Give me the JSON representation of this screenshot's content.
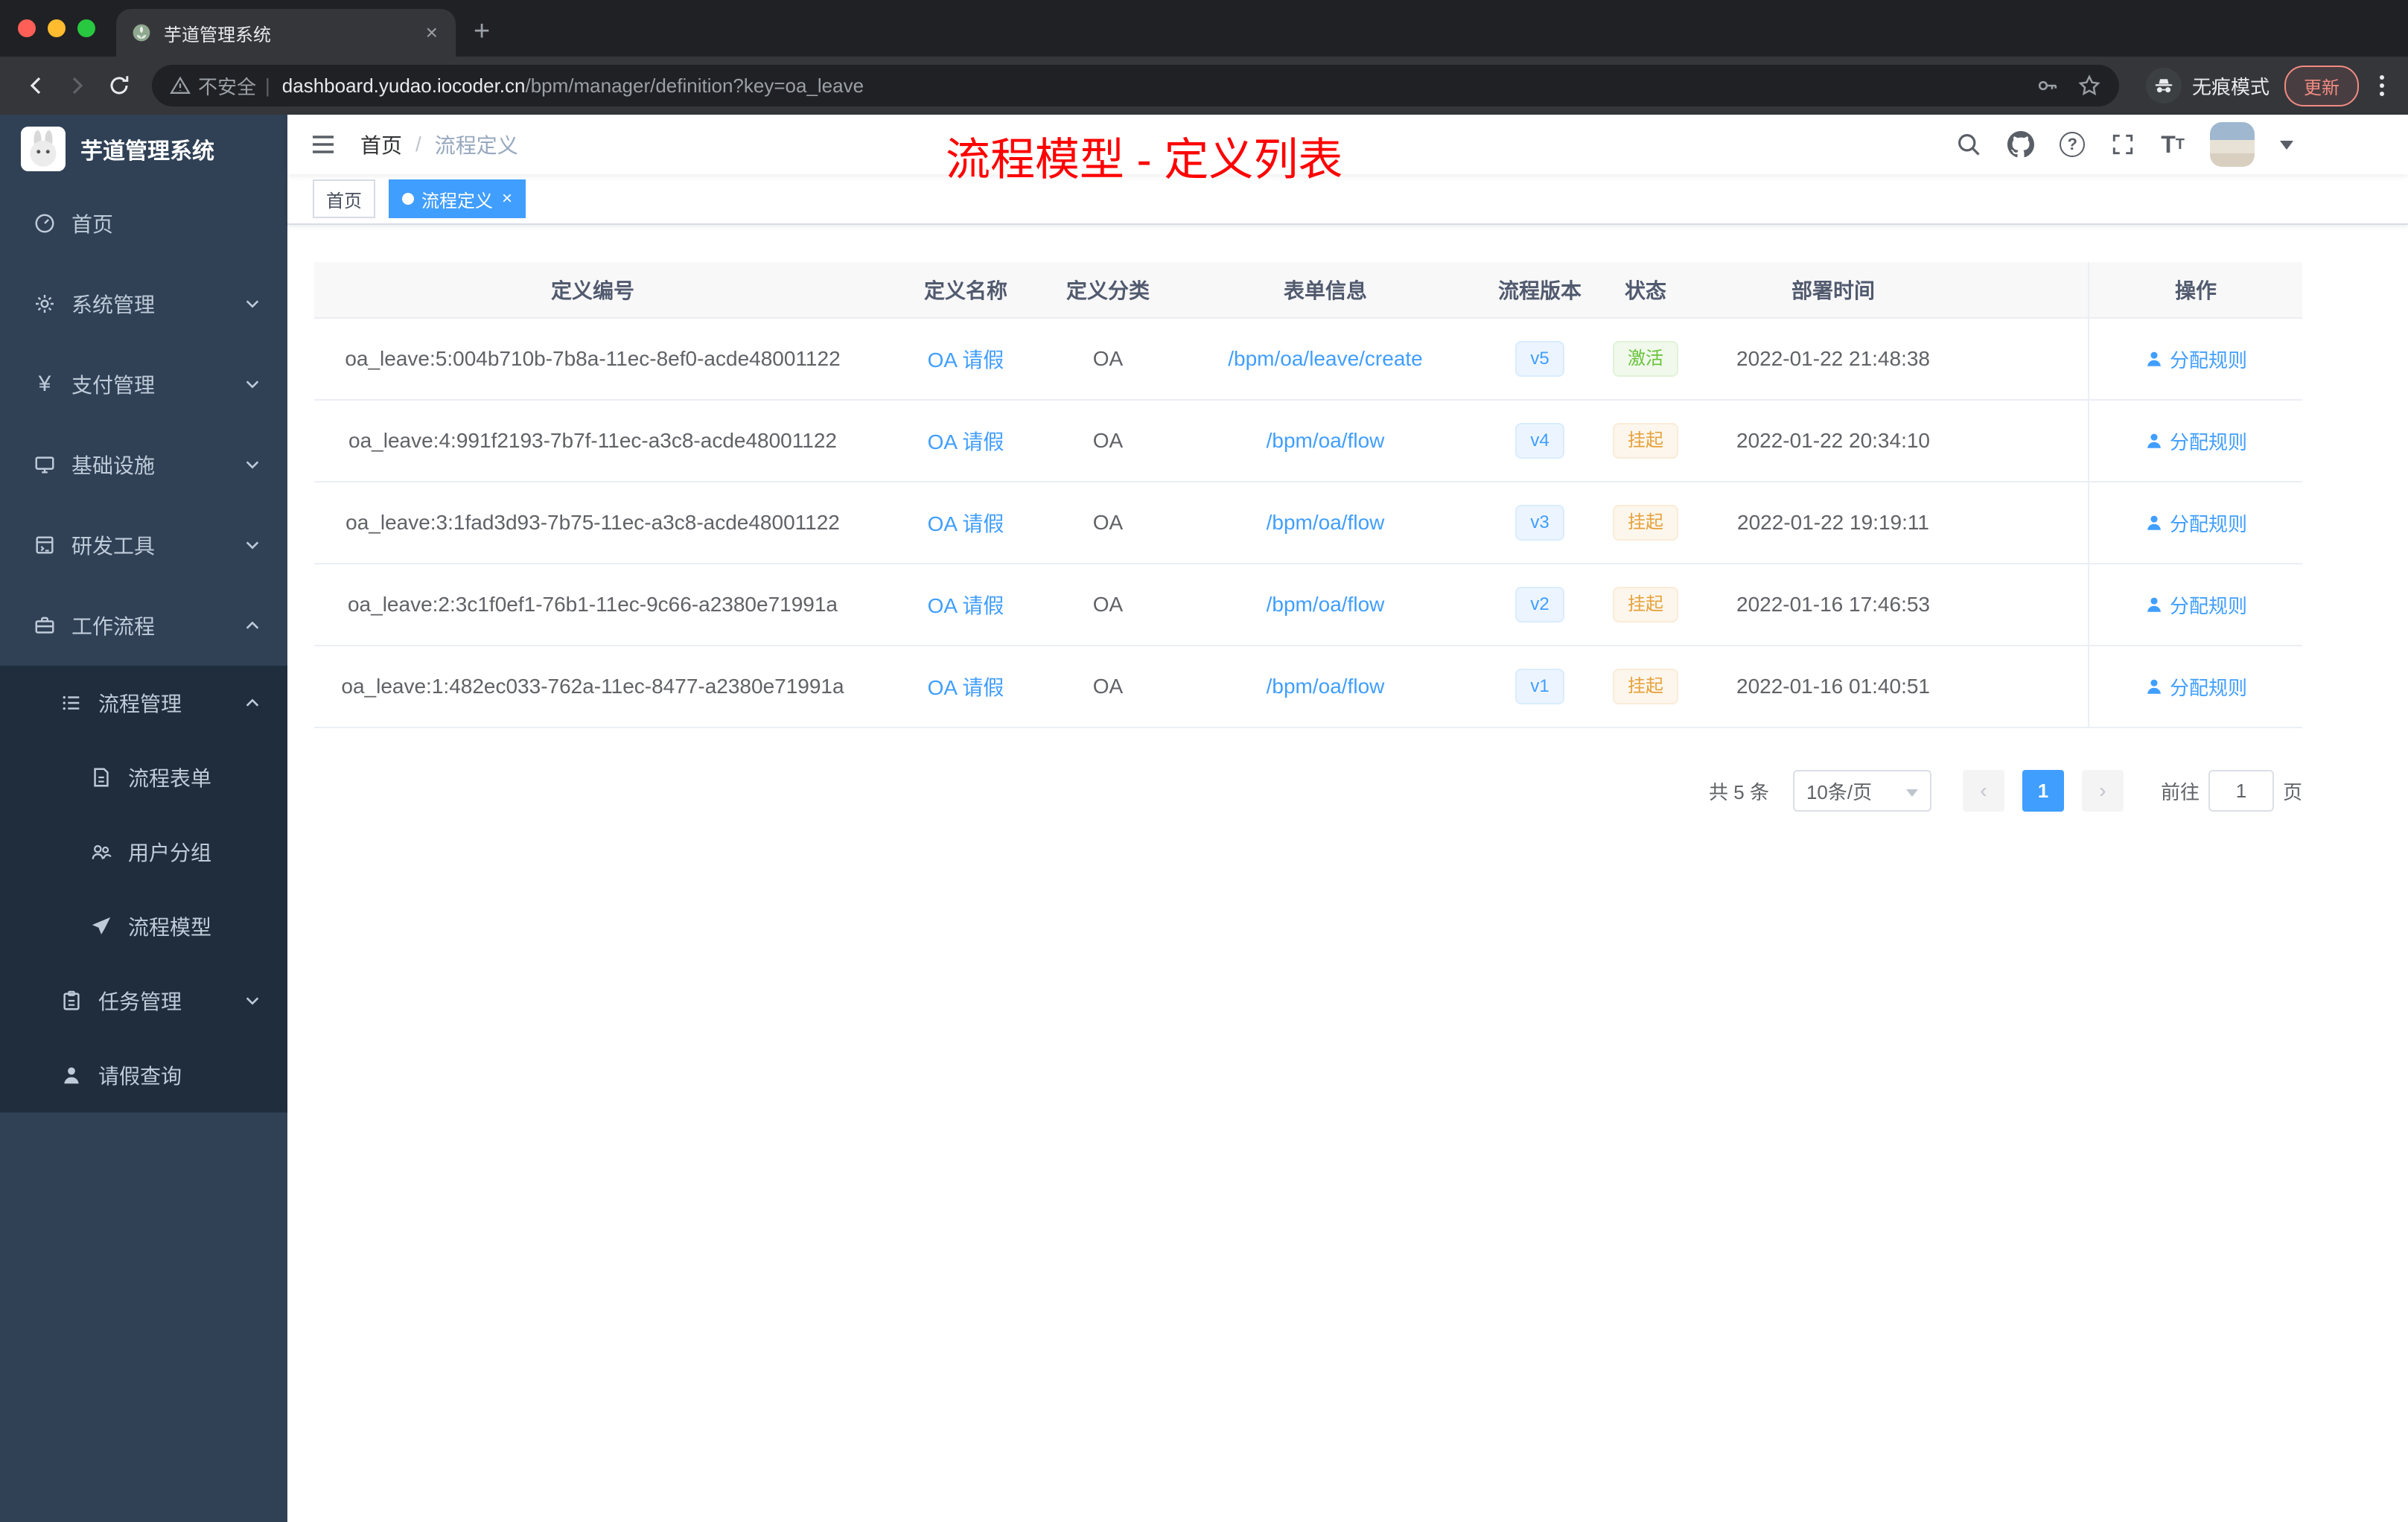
{
  "browser": {
    "tab_title": "芋道管理系统",
    "security_label": "不安全",
    "url_host": "dashboard.yudao.iocoder.cn",
    "url_path": "/bpm/manager/definition?key=oa_leave",
    "incognito_label": "无痕模式",
    "update_label": "更新"
  },
  "sidebar": {
    "logo_title": "芋道管理系统",
    "items": [
      {
        "label": "首页",
        "icon": "dashboard-icon"
      },
      {
        "label": "系统管理",
        "icon": "gear-icon",
        "state": "collapsed"
      },
      {
        "label": "支付管理",
        "icon": "payment-icon",
        "state": "collapsed"
      },
      {
        "label": "基础设施",
        "icon": "infrastructure-icon",
        "state": "collapsed"
      },
      {
        "label": "研发工具",
        "icon": "devtools-icon",
        "state": "collapsed"
      },
      {
        "label": "工作流程",
        "icon": "workflow-icon",
        "state": "expanded"
      },
      {
        "label": "流程管理",
        "icon": "process-manage-icon",
        "state": "expanded"
      },
      {
        "label": "流程表单",
        "icon": "form-icon"
      },
      {
        "label": "用户分组",
        "icon": "user-group-icon"
      },
      {
        "label": "流程模型",
        "icon": "process-model-icon"
      },
      {
        "label": "任务管理",
        "icon": "task-manage-icon",
        "state": "collapsed"
      },
      {
        "label": "请假查询",
        "icon": "leave-query-icon"
      }
    ]
  },
  "navbar": {
    "breadcrumb": {
      "home": "首页",
      "separator": "/",
      "current": "流程定义"
    },
    "annotation": "流程模型 - 定义列表"
  },
  "tags": {
    "home": "首页",
    "active": "流程定义"
  },
  "table": {
    "headers": [
      "定义编号",
      "定义名称",
      "定义分类",
      "表单信息",
      "流程版本",
      "状态",
      "部署时间",
      "操作"
    ],
    "rows": [
      {
        "id": "oa_leave:5:004b710b-7b8a-11ec-8ef0-acde48001122",
        "name": "OA 请假",
        "category": "OA",
        "form": "/bpm/oa/leave/create",
        "version": "v5",
        "status": "激活",
        "deployed": "2022-01-22 21:48:38",
        "action": "分配规则"
      },
      {
        "id": "oa_leave:4:991f2193-7b7f-11ec-a3c8-acde48001122",
        "name": "OA 请假",
        "category": "OA",
        "form": "/bpm/oa/flow",
        "version": "v4",
        "status": "挂起",
        "deployed": "2022-01-22 20:34:10",
        "action": "分配规则"
      },
      {
        "id": "oa_leave:3:1fad3d93-7b75-11ec-a3c8-acde48001122",
        "name": "OA 请假",
        "category": "OA",
        "form": "/bpm/oa/flow",
        "version": "v3",
        "status": "挂起",
        "deployed": "2022-01-22 19:19:11",
        "action": "分配规则"
      },
      {
        "id": "oa_leave:2:3c1f0ef1-76b1-11ec-9c66-a2380e71991a",
        "name": "OA 请假",
        "category": "OA",
        "form": "/bpm/oa/flow",
        "version": "v2",
        "status": "挂起",
        "deployed": "2022-01-16 17:46:53",
        "action": "分配规则"
      },
      {
        "id": "oa_leave:1:482ec033-762a-11ec-8477-a2380e71991a",
        "name": "OA 请假",
        "category": "OA",
        "form": "/bpm/oa/flow",
        "version": "v1",
        "status": "挂起",
        "deployed": "2022-01-16 01:40:51",
        "action": "分配规则"
      }
    ]
  },
  "pagination": {
    "total": "共 5 条",
    "page_size": "10条/页",
    "page": "1",
    "goto_label": "前往",
    "goto_value": "1",
    "unit_label": "页"
  },
  "colors": {
    "accent": "#409eff",
    "annotation_red": "#fe0100",
    "status_active": "#67c23a",
    "status_suspended": "#e6a23c",
    "sidebar_bg": "#304156",
    "sidebar_sub_bg": "#1f2d3d"
  },
  "icons": {
    "search-icon": "magnifier",
    "github-icon": "github octocat",
    "help-icon": "question circle",
    "fullscreen-icon": "expand corners",
    "font-size-icon": "T/t",
    "incognito-icon": "hat and glasses",
    "warning-icon": "triangle !",
    "key-icon": "key",
    "star-icon": "star outline",
    "user-icon": "person",
    "chevron-down-icon": "v",
    "chevron-up-icon": "^"
  }
}
